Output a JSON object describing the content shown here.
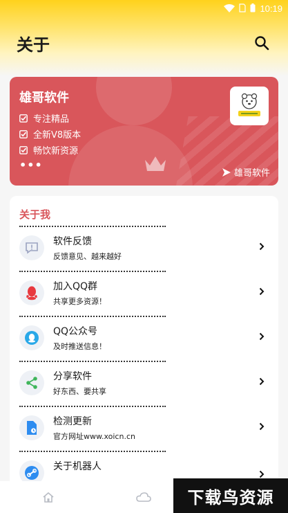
{
  "status_bar": {
    "time": "10:19"
  },
  "header": {
    "title": "关于"
  },
  "banner": {
    "title": "雄哥软件",
    "features": [
      "专注精品",
      "全新V8版本",
      "畅饮新资源"
    ],
    "more": "•••",
    "brand": "雄哥软件"
  },
  "about": {
    "section_title": "关于我",
    "items": [
      {
        "label": "软件反馈",
        "sub": "反馈意见、越来越好",
        "icon": "feedback-icon"
      },
      {
        "label": "加入QQ群",
        "sub": "共享更多资源！",
        "icon": "qq-icon"
      },
      {
        "label": "QQ公众号",
        "sub": "及时推送信息！",
        "icon": "qq-official-icon"
      },
      {
        "label": "分享软件",
        "sub": "好东西、要共享",
        "icon": "share-icon"
      },
      {
        "label": "检测更新",
        "sub": "官方网址www.xoicn.cn",
        "icon": "update-icon"
      },
      {
        "label": "关于机器人",
        "sub": "",
        "icon": "robot-link-icon"
      }
    ]
  },
  "watermark": "下载鸟资源",
  "colors": {
    "accent": "#d9565b",
    "header_yellow": "#ffd21c"
  }
}
